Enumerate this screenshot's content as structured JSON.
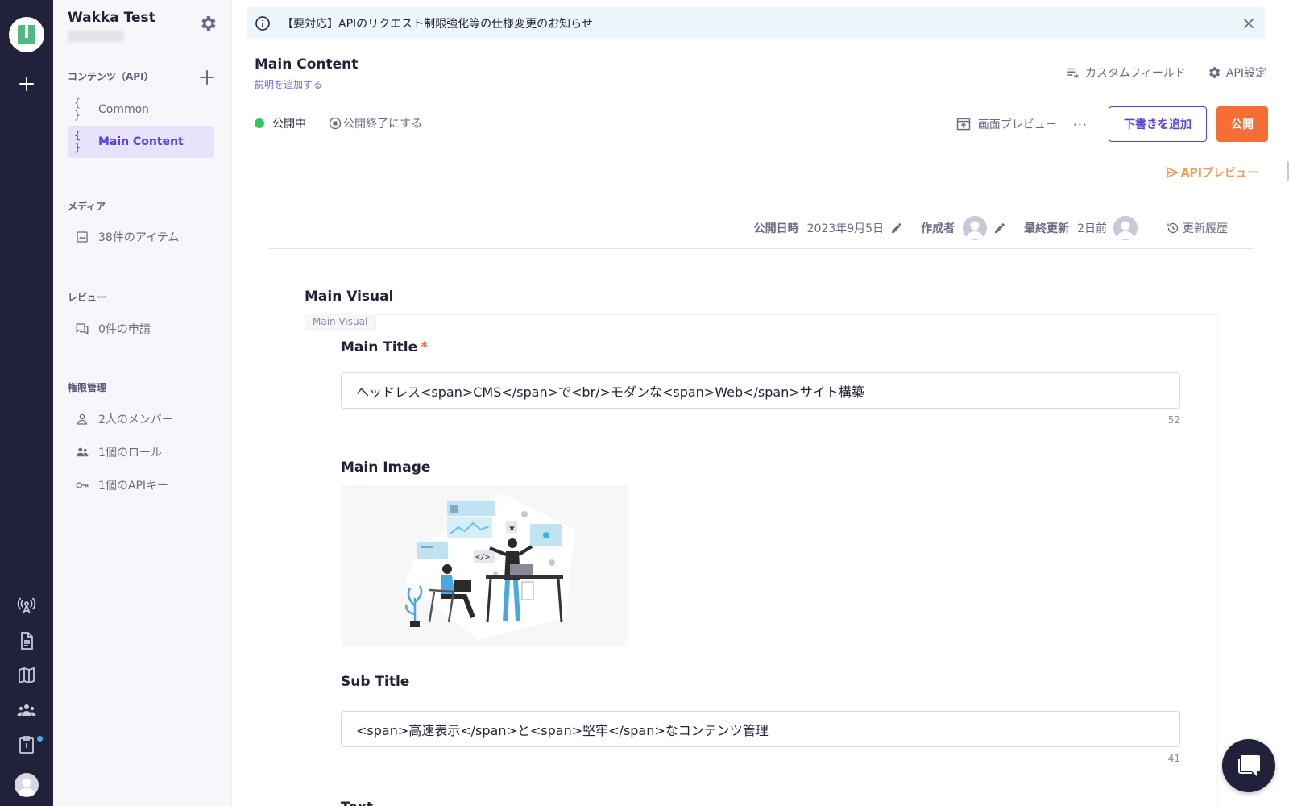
{
  "app": {
    "project_name": "Wakka Test"
  },
  "sidebar": {
    "sections": {
      "contents": "コンテンツ（API）",
      "media": "メディア",
      "review": "レビュー",
      "permissions": "権限管理"
    },
    "content_items": [
      {
        "label": "Common",
        "icon": "braces-icon"
      },
      {
        "label": "Main Content",
        "icon": "braces-icon",
        "active": true
      }
    ],
    "media_items": [
      {
        "label": "38件のアイテム",
        "icon": "image-icon"
      }
    ],
    "review_items": [
      {
        "label": "0件の申請",
        "icon": "chat-icon"
      }
    ],
    "permission_items": [
      {
        "label": "2人のメンバー",
        "icon": "person-icon"
      },
      {
        "label": "1個のロール",
        "icon": "people-icon"
      },
      {
        "label": "1個のAPIキー",
        "icon": "key-icon"
      }
    ]
  },
  "banner": {
    "text": "【要対応】APIのリクエスト制限強化等の仕様変更のお知らせ"
  },
  "header": {
    "title": "Main Content",
    "description": "説明を追加する",
    "custom_field": "カスタムフィールド",
    "api_settings": "API設定",
    "status": "公開中",
    "unpublish": "公開終了にする",
    "screen_preview": "画面プレビュー",
    "more": "···",
    "add_draft": "下書きを追加",
    "publish": "公開",
    "api_preview": "APIプレビュー"
  },
  "meta": {
    "publish_date_label": "公開日時",
    "publish_date_value": "2023年9月5日",
    "author_label": "作成者",
    "last_updated_label": "最終更新",
    "last_updated_value": "2日前",
    "history": "更新履歴"
  },
  "form": {
    "group_title": "Main Visual",
    "group_tag": "Main Visual",
    "main_title": {
      "label": "Main Title",
      "required_mark": "*",
      "value": "ヘッドレス<span>CMS</span>で<br/>モダンな<span>Web</span>サイト構築",
      "count": "52"
    },
    "main_image": {
      "label": "Main Image"
    },
    "sub_title": {
      "label": "Sub Title",
      "value": "<span>高速表示</span>と<span>堅牢</span>なコンテンツ管理",
      "count": "41"
    },
    "text_label": "Text"
  },
  "colors": {
    "rail": "#21213b",
    "accent": "#5a3fe0",
    "publish": "#f56e36",
    "status_green": "#2ec85f",
    "banner_bg": "#ecf6fb"
  }
}
